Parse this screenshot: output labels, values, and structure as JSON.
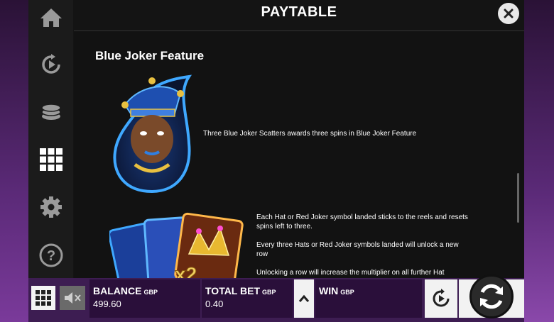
{
  "header": {
    "title": "PAYTABLE"
  },
  "section": {
    "title": "Blue Joker Feature",
    "desc1": "Three Blue Joker Scatters awards three spins in Blue Joker Feature",
    "desc2_p1": "Each Hat or Red Joker symbol landed sticks to the reels and resets spins left to three.",
    "desc2_p2": "Every three Hats or Red Joker symbols landed will unlock a new row",
    "desc2_p3": "Unlocking a row will increase the multiplier on all further Hat"
  },
  "side_nav": [
    "home-icon",
    "autoplay-icon",
    "coins-icon",
    "paytable-grid-icon",
    "settings-icon",
    "help-icon"
  ],
  "bottom_bar": {
    "balance_label": "BALANCE",
    "balance_currency": "GBP",
    "balance_value": "499.60",
    "total_bet_label": "TOTAL BET",
    "total_bet_currency": "GBP",
    "total_bet_value": "0.40",
    "win_label": "WIN",
    "win_currency": "GBP"
  },
  "colors": {
    "accent_blue": "#2f7fe0",
    "panel_bg": "#121212",
    "bar_bg": "#2a0f3a"
  }
}
